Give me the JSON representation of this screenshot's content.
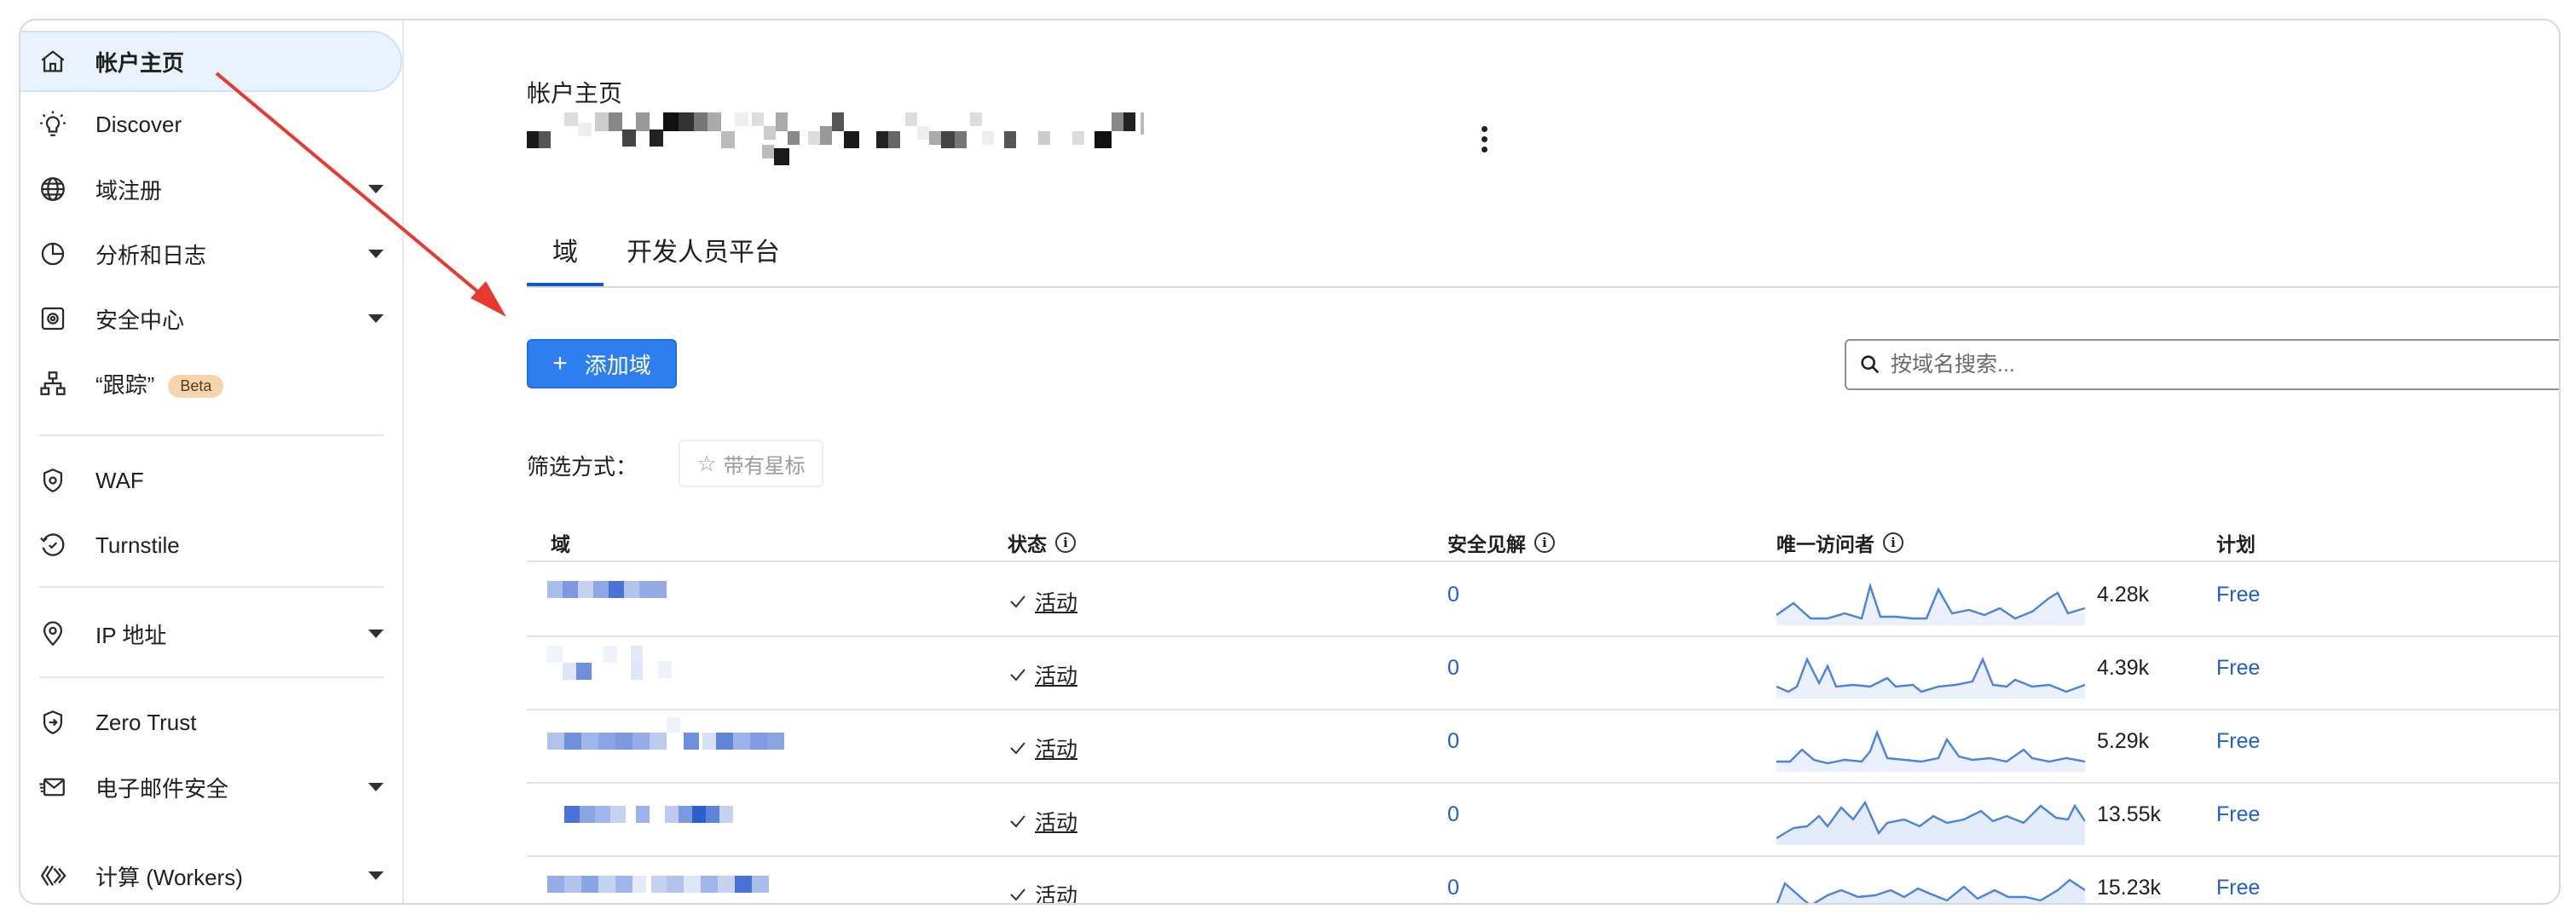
{
  "sidebar": {
    "items": [
      {
        "label": "帐户主页",
        "icon": "home-icon",
        "active": true,
        "caret": false
      },
      {
        "label": "Discover",
        "icon": "lightbulb-icon",
        "active": false,
        "caret": false
      },
      {
        "label": "域注册",
        "icon": "globe-icon",
        "active": false,
        "caret": true
      },
      {
        "label": "分析和日志",
        "icon": "pie-chart-icon",
        "active": false,
        "caret": true
      },
      {
        "label": "安全中心",
        "icon": "safe-icon",
        "active": false,
        "caret": true
      },
      {
        "label": "“跟踪”",
        "icon": "sitemap-icon",
        "active": false,
        "caret": false,
        "badge": "Beta"
      },
      {
        "label": "WAF",
        "icon": "shield-gear-icon",
        "active": false,
        "caret": false
      },
      {
        "label": "Turnstile",
        "icon": "turnstile-icon",
        "active": false,
        "caret": false
      },
      {
        "label": "IP 地址",
        "icon": "location-pin-icon",
        "active": false,
        "caret": true
      },
      {
        "label": "Zero Trust",
        "icon": "zero-trust-icon",
        "active": false,
        "caret": false
      },
      {
        "label": "电子邮件安全",
        "icon": "email-icon",
        "active": false,
        "caret": true
      },
      {
        "label": "计算 (Workers)",
        "icon": "workers-icon",
        "active": false,
        "caret": true
      }
    ]
  },
  "main": {
    "account_title": "帐户主页",
    "tabs": [
      {
        "label": "域",
        "active": true
      },
      {
        "label": "开发人员平台",
        "active": false
      }
    ],
    "add_button_label": "添加域",
    "search_placeholder": "按域名搜索...",
    "filter_label": "筛选方式：",
    "star_filter_label": "带有星标"
  },
  "table": {
    "headers": {
      "domain": "域",
      "status": "状态",
      "insights": "安全见解",
      "visitors": "唯一访问者",
      "plan": "计划"
    },
    "rows": [
      {
        "status": "活动",
        "insights": "0",
        "visitors": "4.28k",
        "plan": "Free"
      },
      {
        "status": "活动",
        "insights": "0",
        "visitors": "4.39k",
        "plan": "Free"
      },
      {
        "status": "活动",
        "insights": "0",
        "visitors": "5.29k",
        "plan": "Free"
      },
      {
        "status": "活动",
        "insights": "0",
        "visitors": "13.55k",
        "plan": "Free"
      },
      {
        "status": "活动",
        "insights": "0",
        "visitors": "15.23k",
        "plan": "Free"
      }
    ]
  },
  "colors": {
    "accent": "#2f7ef0",
    "link": "#1f5ecb",
    "annotation_arrow": "#e8392f"
  }
}
